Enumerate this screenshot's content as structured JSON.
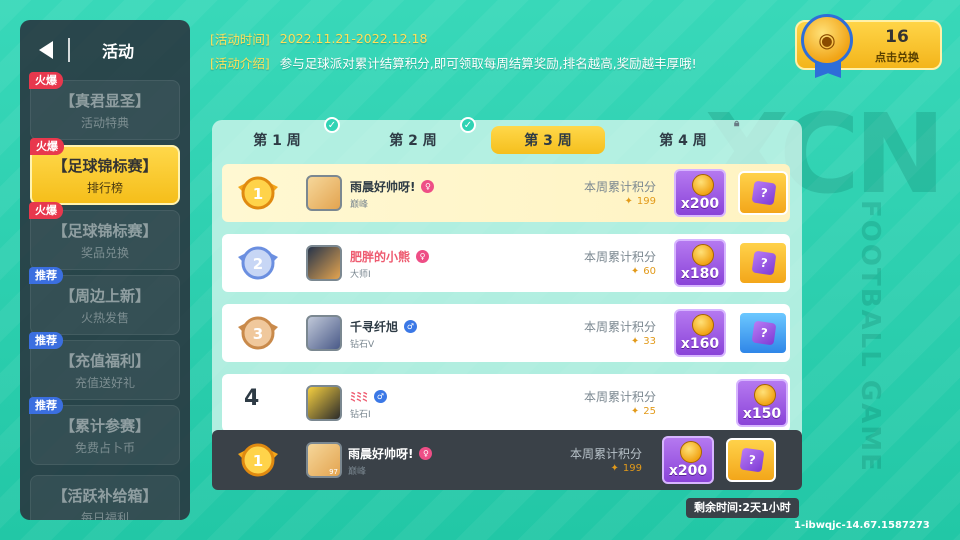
{
  "sidebar": {
    "title": "活动",
    "items": [
      {
        "badge": "火爆",
        "badge_type": "hot",
        "line1": "【真君显圣】",
        "line2": "活动特典",
        "active": false
      },
      {
        "badge": "火爆",
        "badge_type": "hot",
        "line1": "【足球锦标赛】",
        "line2": "排行榜",
        "active": true
      },
      {
        "badge": "火爆",
        "badge_type": "hot",
        "line1": "【足球锦标赛】",
        "line2": "奖品兑换",
        "active": false
      },
      {
        "badge": "推荐",
        "badge_type": "rec",
        "line1": "【周边上新】",
        "line2": "火热发售",
        "active": false
      },
      {
        "badge": "推荐",
        "badge_type": "rec",
        "line1": "【充值福利】",
        "line2": "充值送好礼",
        "active": false
      },
      {
        "badge": "推荐",
        "badge_type": "rec",
        "line1": "【累计参赛】",
        "line2": "免费占卜币",
        "active": false
      },
      {
        "badge": "",
        "badge_type": "",
        "line1": "【活跃补给箱】",
        "line2": "每日福利",
        "active": false
      }
    ]
  },
  "info": {
    "time_label": "[活动时间]",
    "time_value": "2022.11.21-2022.12.18",
    "desc_label": "[活动介绍]",
    "desc_value": "参与足球派对累计结算积分,即可领取每周结算奖励,排名越高,奖励越丰厚哦!"
  },
  "redeem": {
    "count": "16",
    "label": "点击兑换"
  },
  "tabs": [
    {
      "label": "第 1 周",
      "state": "done"
    },
    {
      "label": "第 2 周",
      "state": "done"
    },
    {
      "label": "第 3 周",
      "state": "active"
    },
    {
      "label": "第 4 周",
      "state": "locked"
    }
  ],
  "score_label": "本周累计积分",
  "rows": [
    {
      "rank": "1",
      "name": "雨晨好帅呀!",
      "sex": "f",
      "title": "巅峰",
      "score": "199",
      "reward_qty": "x200",
      "box": "gold"
    },
    {
      "rank": "2",
      "name": "肥胖的小熊",
      "sex": "f",
      "title": "大师I",
      "score": "60",
      "reward_qty": "x180",
      "box": "gold"
    },
    {
      "rank": "3",
      "name": "千寻纤旭",
      "sex": "m",
      "title": "钻石V",
      "score": "33",
      "reward_qty": "x160",
      "box": "blue"
    },
    {
      "rank": "4",
      "name": "ﾐﾐﾐ",
      "sex": "m",
      "title": "钻石I",
      "score": "25",
      "reward_qty": "x150",
      "box": ""
    }
  ],
  "self_row": {
    "rank": "1",
    "name": "雨晨好帅呀!",
    "sex": "f",
    "title": "巅峰",
    "avatar_tag": "97",
    "score": "199",
    "reward_qty": "x200",
    "box": "gold"
  },
  "remaining": "剩余时间:2天1小时",
  "session_id": "1-ibwqjc-14.67.1587273",
  "colors": {
    "accent": "#f5be1a",
    "teal": "#2fd3b4",
    "reward_purple": "#8a43d8"
  }
}
